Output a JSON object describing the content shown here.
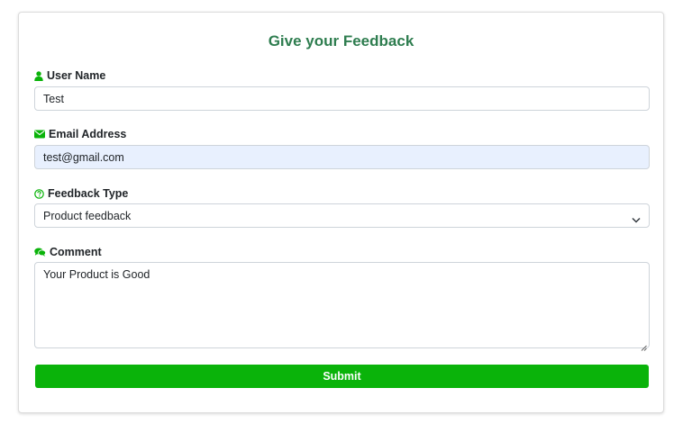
{
  "form": {
    "title": "Give your Feedback",
    "accent_color": "#2e7d4f",
    "icon_color": "#0ab30a",
    "user_name": {
      "label": "User Name",
      "icon": "user-icon",
      "value": "Test"
    },
    "email": {
      "label": "Email Address",
      "icon": "envelope-icon",
      "value": "test@gmail.com"
    },
    "feedback_type": {
      "label": "Feedback Type",
      "icon": "question-circle-icon",
      "selected": "Product feedback"
    },
    "comment": {
      "label": "Comment",
      "icon": "comments-icon",
      "value": "Your Product is Good"
    },
    "submit_label": "Submit",
    "submit_color": "#0ab30a"
  }
}
